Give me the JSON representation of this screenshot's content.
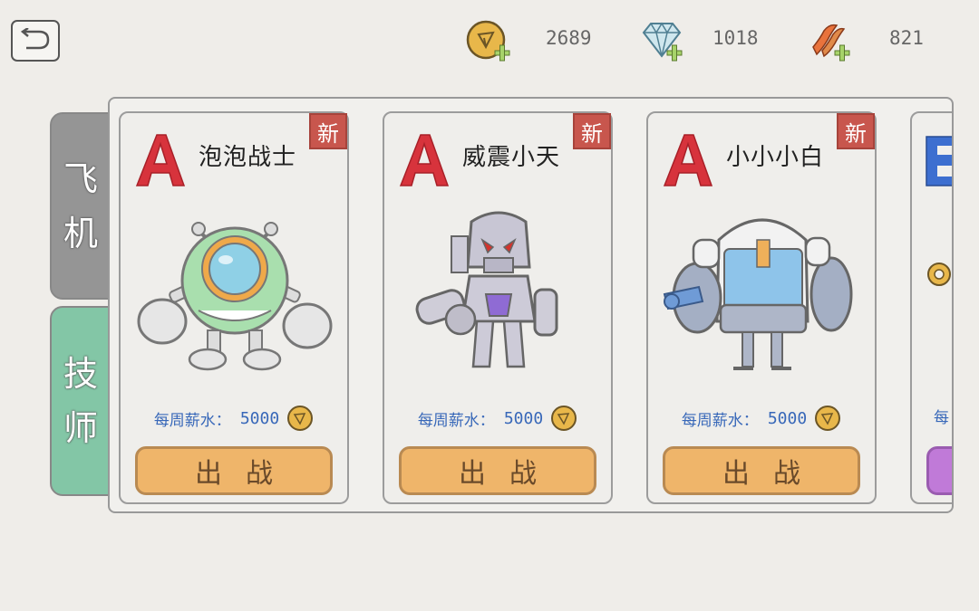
{
  "header": {
    "back_icon": "back-arrow-icon",
    "resources": [
      {
        "name": "gold",
        "icon": "gold-coin-plus-icon",
        "value": "2689"
      },
      {
        "name": "gem",
        "icon": "diamond-plus-icon",
        "value": "1018"
      },
      {
        "name": "food",
        "icon": "bacon-plus-icon",
        "value": "821"
      }
    ]
  },
  "sidebar": {
    "tabs": [
      {
        "line1": "飞",
        "line2": "机",
        "color": "#959595"
      },
      {
        "line1": "技",
        "line2": "师",
        "color": "#83c6a6"
      }
    ]
  },
  "cards": [
    {
      "grade": "A",
      "name": "泡泡战士",
      "badge": "新",
      "salary_label": "每周薪水：",
      "salary": "5000",
      "button": "出战",
      "art": "green-bubble-robot"
    },
    {
      "grade": "A",
      "name": "威震小天",
      "badge": "新",
      "salary_label": "每周薪水：",
      "salary": "5000",
      "button": "出战",
      "art": "purple-red-eyed-robot"
    },
    {
      "grade": "A",
      "name": "小小小白",
      "badge": "新",
      "salary_label": "每周薪水：",
      "salary": "5000",
      "button": "出战",
      "art": "white-blue-robot"
    },
    {
      "grade": "B",
      "salary_label": "每",
      "art": "partial-card"
    }
  ],
  "colors": {
    "grade_a": "#d7333c",
    "grade_b": "#3d6fd0",
    "salary": "#3868b9",
    "button": "#efb56a"
  }
}
